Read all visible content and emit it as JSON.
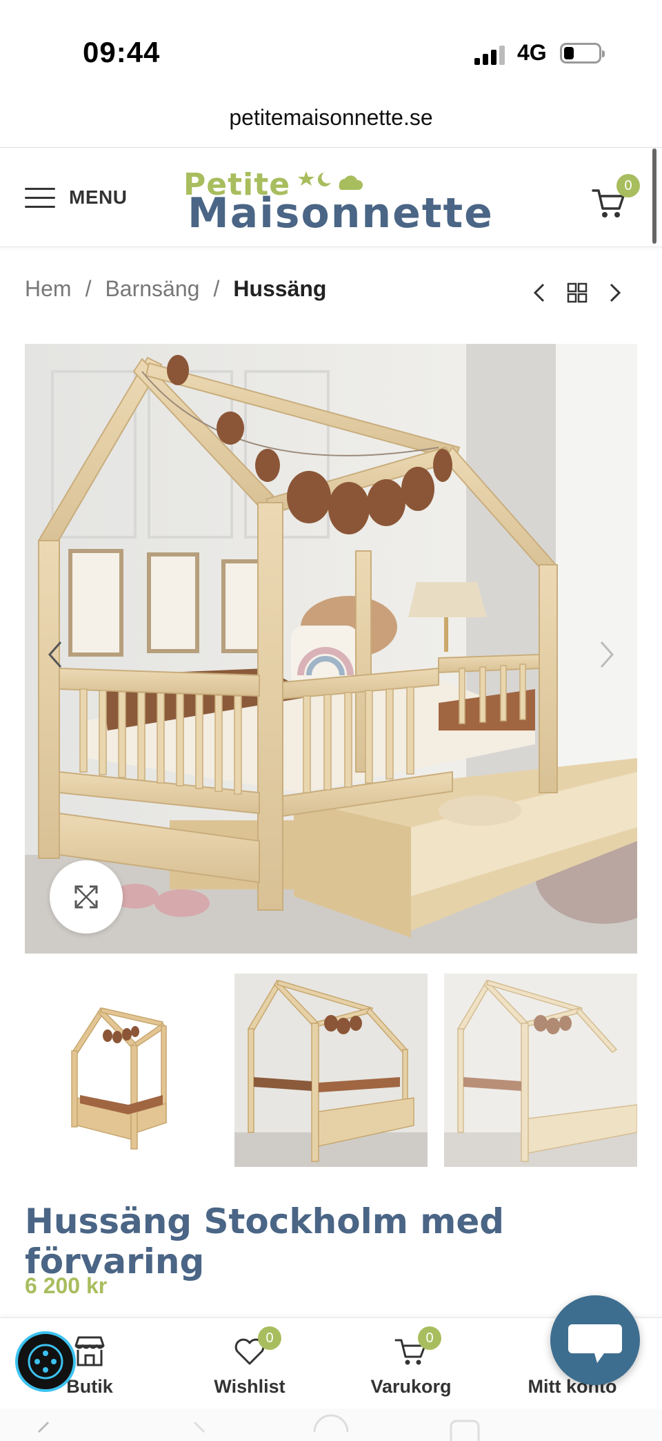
{
  "status_bar": {
    "time": "09:44",
    "network": "4G",
    "battery_icon": "battery-low-icon",
    "signal_icon": "signal-icon"
  },
  "browser": {
    "url": "petitemaisonnette.se"
  },
  "header": {
    "menu_label": "MENU",
    "menu_icon": "hamburger-icon",
    "logo_line1": "Petite",
    "logo_line2": "Maisonnette",
    "cart_count": "0",
    "cart_icon": "cart-icon"
  },
  "breadcrumb": {
    "items": [
      "Hem",
      "Barnsäng"
    ],
    "current": "Hussäng",
    "separator": "/"
  },
  "product_nav": {
    "prev_icon": "chevron-left-icon",
    "grid_icon": "grid-icon",
    "next_icon": "chevron-right-icon"
  },
  "gallery": {
    "main_alt": "Hussäng med förvaring",
    "zoom_icon": "expand-icon",
    "thumbnail_count": 3
  },
  "product": {
    "title": "Hussäng Stockholm med förvaring",
    "price": "6 200 kr"
  },
  "bottom_bar": {
    "tabs": [
      {
        "label": "Butik",
        "icon": "store-icon"
      },
      {
        "label": "Wishlist",
        "icon": "heart-icon",
        "badge": "0"
      },
      {
        "label": "Varukorg",
        "icon": "cart-icon",
        "badge": "0"
      },
      {
        "label": "Mitt konto",
        "icon": "user-icon"
      }
    ]
  },
  "colors": {
    "brand_green": "#a8bd5e",
    "brand_blue": "#4a6585",
    "chat_blue": "#3e6e8f",
    "a11y_cyan": "#3cc2f0"
  }
}
